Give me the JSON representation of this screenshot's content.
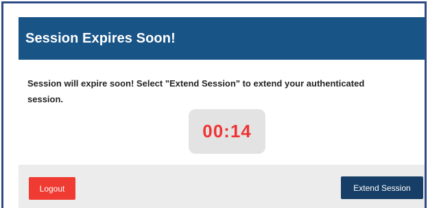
{
  "dialog": {
    "title": "Session Expires Soon!",
    "message": "Session will expire soon! Select \"Extend Session\" to extend your authenticated session.",
    "countdown": "00:14",
    "logout_label": "Logout",
    "extend_label": "Extend Session"
  },
  "colors": {
    "header_bg": "#195487",
    "countdown_text": "#ef3333",
    "logout_bg": "#ef3b32",
    "extend_bg": "#173e66",
    "frame_border": "#2d4a86"
  }
}
